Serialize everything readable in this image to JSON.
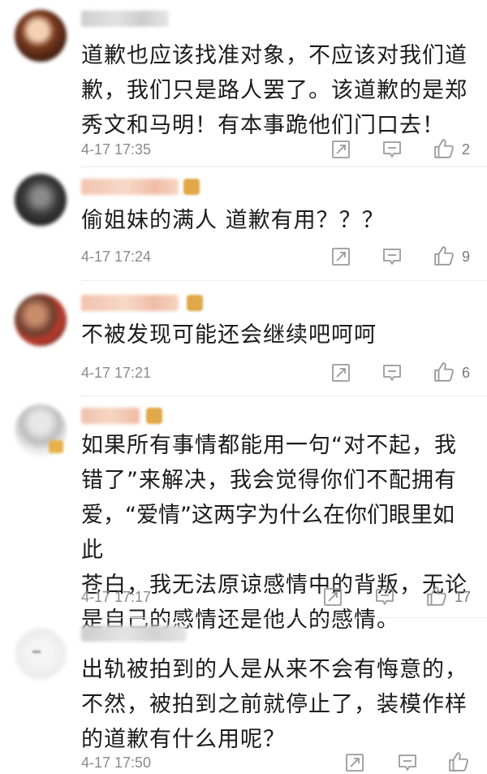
{
  "colors": {
    "text": "#1b1b1b",
    "meta": "#8a8a8a",
    "icon": "#9a9a9a",
    "badge": "#e0a848"
  },
  "comments": [
    {
      "lines": [
        "道歉也应该找准对象，不应该对我们道",
        "歉，我们只是路人罢了。该道歉的是郑",
        "秀文和马明！有本事跪他们门口去！"
      ],
      "time": "4-17 17:35",
      "likes": "2"
    },
    {
      "lines": [
        "偷姐妹的满人 道歉有用？？？"
      ],
      "time": "4-17 17:24",
      "likes": "9"
    },
    {
      "lines": [
        "不被发现可能还会继续吧呵呵"
      ],
      "time": "4-17 17:21",
      "likes": "6"
    },
    {
      "lines": [
        "如果所有事情都能用一句“对不起，我",
        "错了”来解决，我会觉得你们不配拥有",
        "爱，“爱情”这两字为什么在你们眼里如此",
        "苍白，我无法原谅感情中的背叛，无论",
        "是自己的感情还是他人的感情。"
      ],
      "time": "4-17 17:17",
      "likes": "17"
    },
    {
      "lines": [
        "出轨被拍到的人是从来不会有悔意的，",
        "不然，被拍到之前就停止了，装模作样",
        "的道歉有什么用呢？"
      ],
      "time": "4-17 17:50",
      "likes": ""
    }
  ]
}
